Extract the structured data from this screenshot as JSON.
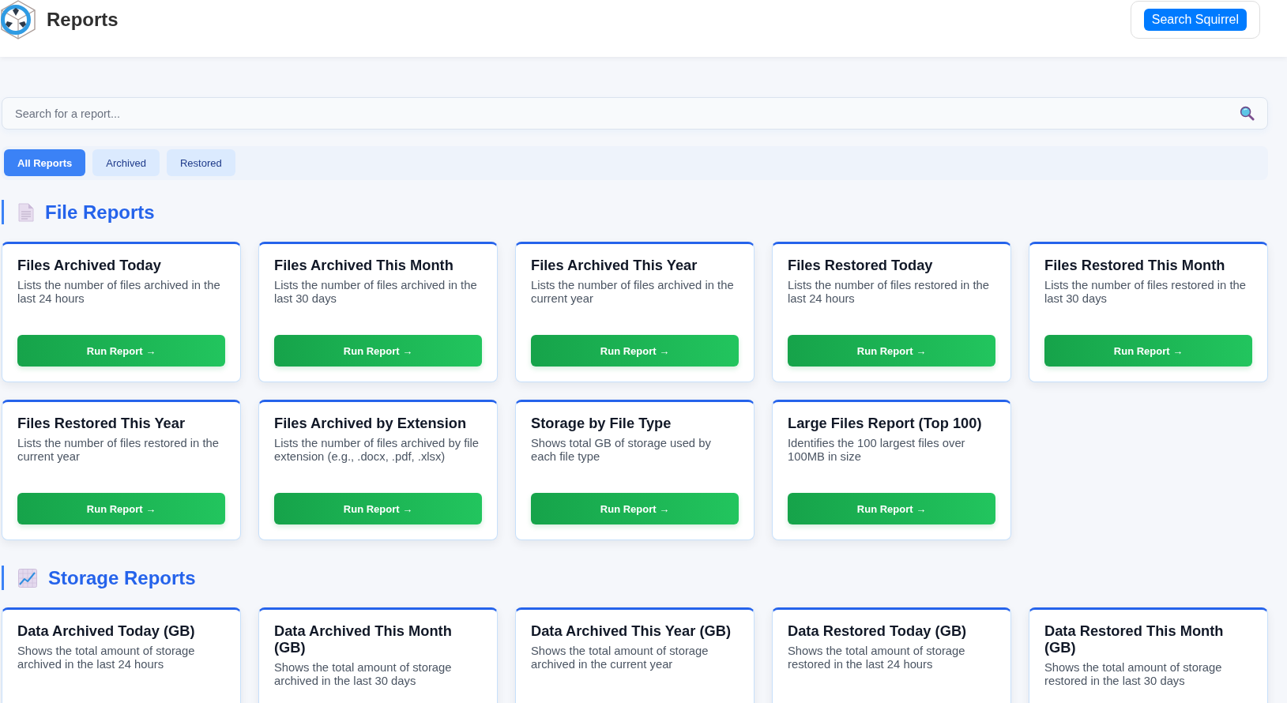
{
  "header": {
    "title": "Reports",
    "button": "Search Squirrel"
  },
  "search": {
    "placeholder": "Search for a report..."
  },
  "filter_tabs": [
    {
      "label": "All Reports",
      "selected": true
    },
    {
      "label": "Archived",
      "selected": false
    },
    {
      "label": "Restored",
      "selected": false
    }
  ],
  "sections": [
    {
      "title": "File Reports",
      "kind": "files",
      "cards": [
        {
          "title": "Files Archived Today",
          "description": "Lists the number of files archived in the last 24 hours",
          "button": "Run Report →"
        },
        {
          "title": "Files Archived This Month",
          "description": "Lists the number of files archived in the last 30 days",
          "button": "Run Report →"
        },
        {
          "title": "Files Archived This Year",
          "description": "Lists the number of files archived in the current year",
          "button": "Run Report →"
        },
        {
          "title": "Files Restored Today",
          "description": "Lists the number of files restored in the last 24 hours",
          "button": "Run Report →"
        },
        {
          "title": "Files Restored This Month",
          "description": "Lists the number of files restored in the last 30 days",
          "button": "Run Report →"
        },
        {
          "title": "Files Restored This Year",
          "description": "Lists the number of files restored in the current year",
          "button": "Run Report →"
        },
        {
          "title": "Files Archived by Extension",
          "description": "Lists the number of files archived by file extension (e.g., .docx, .pdf, .xlsx)",
          "button": "Run Report →"
        },
        {
          "title": "Storage by File Type",
          "description": "Shows total GB of storage used by each file type",
          "button": "Run Report →"
        },
        {
          "title": "Large Files Report (Top 100)",
          "description": "Identifies the 100 largest files over 100MB in size",
          "button": "Run Report →"
        }
      ]
    },
    {
      "title": "Storage Reports",
      "kind": "storage",
      "cards": [
        {
          "title": "Data Archived Today (GB)",
          "description": "Shows the total amount of storage archived in the last 24 hours"
        },
        {
          "title": "Data Archived This Month (GB)",
          "description": "Shows the total amount of storage archived in the last 30 days"
        },
        {
          "title": "Data Archived This Year (GB)",
          "description": "Shows the total amount of storage archived in the current year"
        },
        {
          "title": "Data Restored Today (GB)",
          "description": "Shows the total amount of storage restored in the last 24 hours"
        },
        {
          "title": "Data Restored This Month (GB)",
          "description": "Shows the total amount of storage restored in the last 30 days"
        }
      ]
    }
  ]
}
